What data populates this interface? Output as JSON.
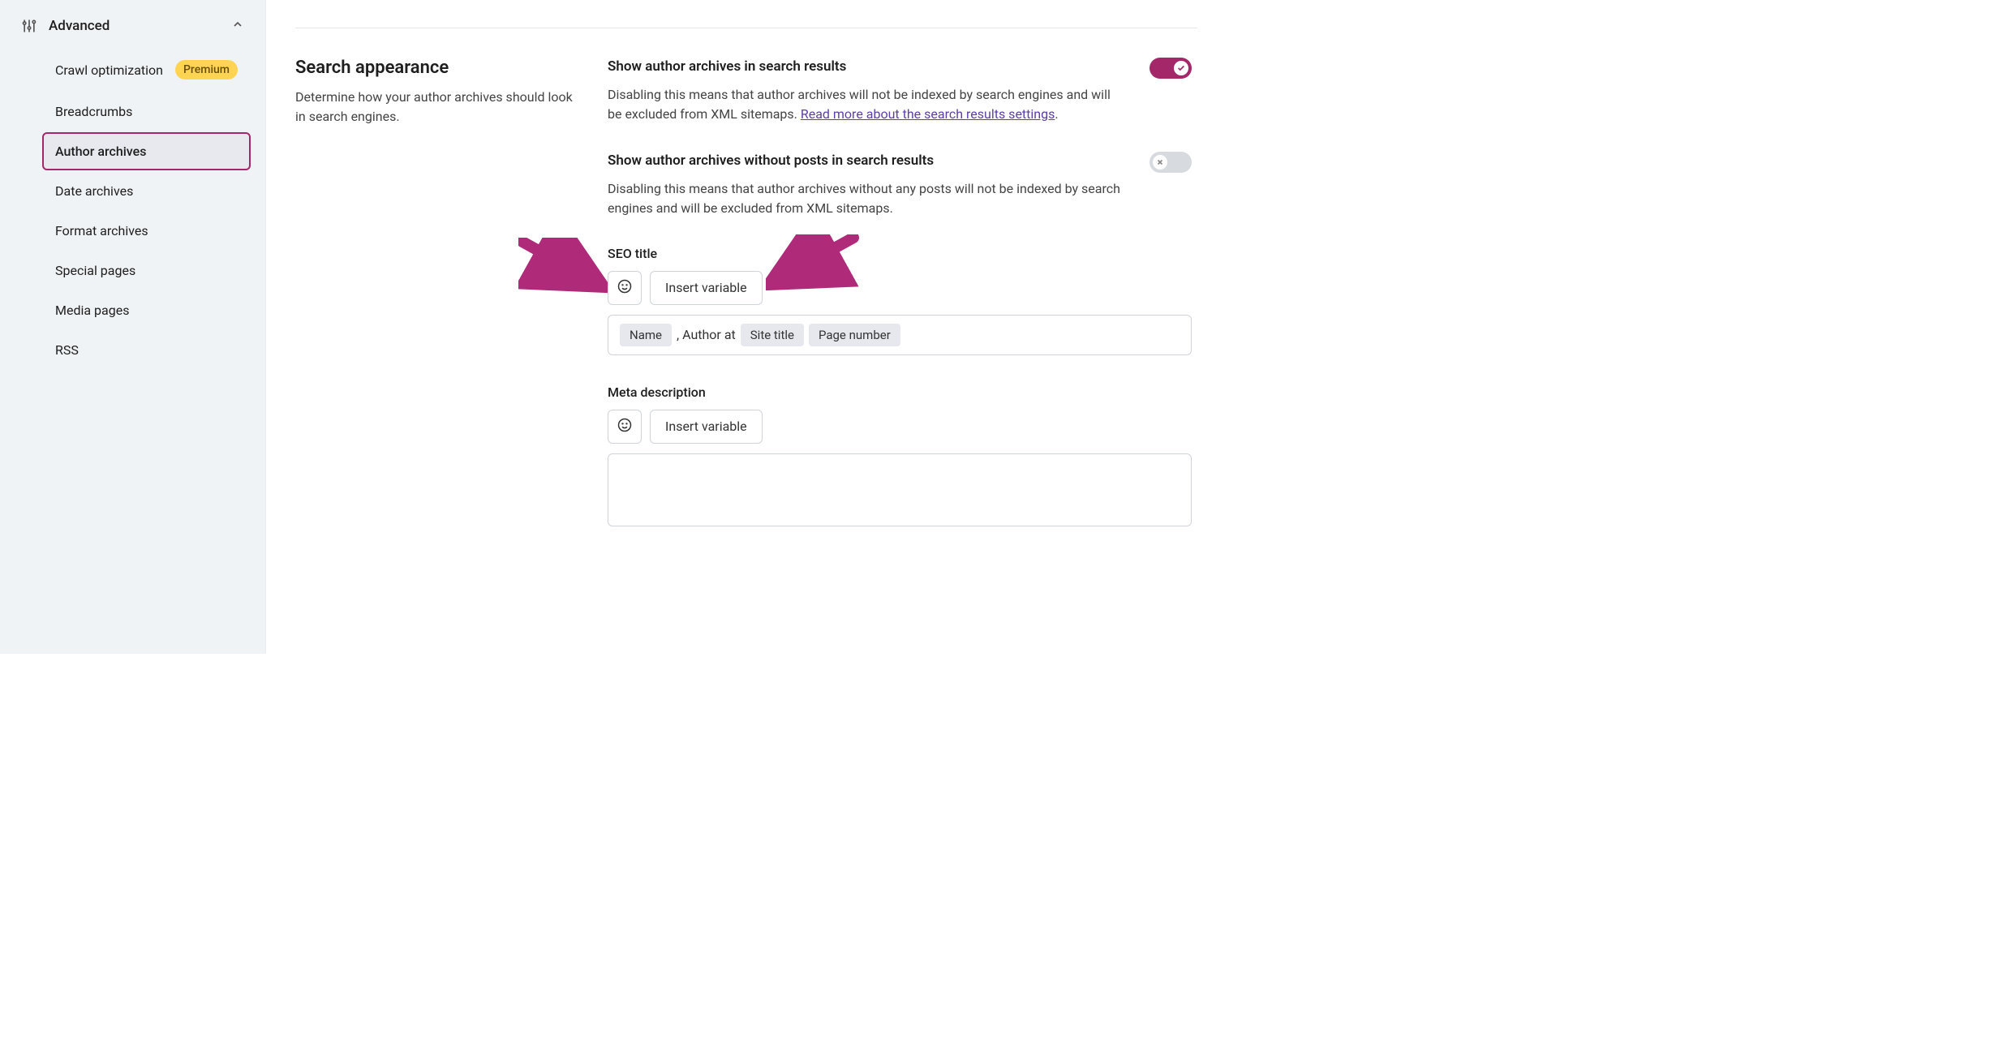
{
  "sidebar": {
    "section": {
      "label": "Advanced"
    },
    "items": [
      {
        "label": "Crawl optimization",
        "badge": "Premium",
        "selected": false
      },
      {
        "label": "Breadcrumbs",
        "selected": false
      },
      {
        "label": "Author archives",
        "selected": true
      },
      {
        "label": "Date archives",
        "selected": false
      },
      {
        "label": "Format archives",
        "selected": false
      },
      {
        "label": "Special pages",
        "selected": false
      },
      {
        "label": "Media pages",
        "selected": false
      },
      {
        "label": "RSS",
        "selected": false
      }
    ]
  },
  "page": {
    "heading": "Search appearance",
    "subheading": "Determine how your author archives should look in search engines."
  },
  "settings": {
    "show_in_search": {
      "title": "Show author archives in search results",
      "desc_pre": "Disabling this means that author archives will not be indexed by search engines and will be excluded from XML sitemaps. ",
      "link_text": "Read more about the search results settings",
      "desc_post": ".",
      "on": true
    },
    "show_without_posts": {
      "title": "Show author archives without posts in search results",
      "desc": "Disabling this means that author archives without any posts will not be indexed by search engines and will be excluded from XML sitemaps.",
      "on": false
    }
  },
  "seo_title": {
    "label": "SEO title",
    "insert_variable": "Insert variable",
    "tokens": {
      "name": "Name",
      "sep_text": ", Author at ",
      "site_title": "Site title",
      "page_number": "Page number"
    }
  },
  "meta_description": {
    "label": "Meta description",
    "insert_variable": "Insert variable"
  },
  "colors": {
    "accent": "#a4276a",
    "link": "#5d3ea8",
    "badge_bg": "#ffd452"
  }
}
